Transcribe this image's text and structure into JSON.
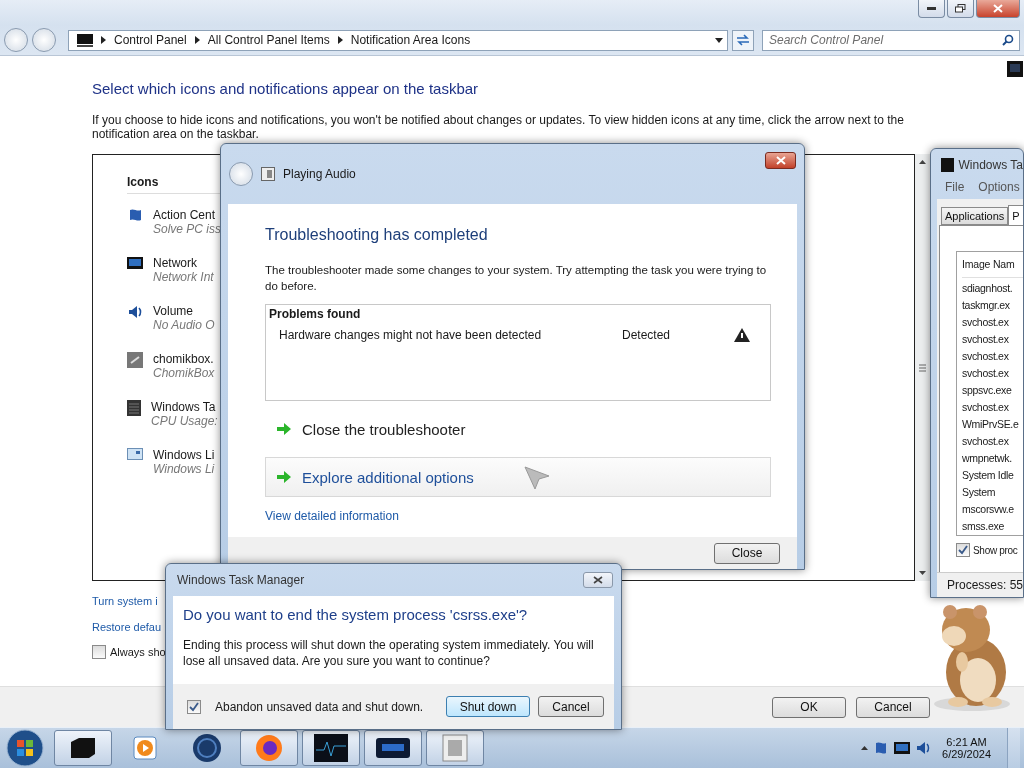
{
  "explorer": {
    "address": [
      "Control Panel",
      "All Control Panel Items",
      "Notification Area Icons"
    ],
    "search": {
      "placeholder": "Search Control Panel"
    },
    "heading": "Select which icons and notifications appear on the taskbar",
    "description": "If you choose to hide icons and notifications, you won't be notified about changes or updates. To view hidden icons at any time, click the arrow next to the notification area on the taskbar.",
    "icons_header": "Icons",
    "icons": [
      {
        "name": "Action Cent",
        "detail": "Solve PC iss"
      },
      {
        "name": "Network",
        "detail": "Network Int"
      },
      {
        "name": "Volume",
        "detail": "No Audio O"
      },
      {
        "name": "chomikbox.",
        "detail": "ChomikBox"
      },
      {
        "name": "Windows Ta",
        "detail": "CPU Usage:"
      },
      {
        "name": "Windows Li",
        "detail": "Windows Li"
      }
    ],
    "links": [
      "Turn system i",
      "Restore defau"
    ],
    "always_show": {
      "label": "Always sho",
      "checked": false
    },
    "buttons": [
      "OK",
      "Cancel"
    ]
  },
  "troubleshooter": {
    "title": "Playing Audio",
    "heading": "Troubleshooting has completed",
    "message": "The troubleshooter made some changes to your system. Try attempting the task you were trying to do before.",
    "problems_header": "Problems found",
    "problems": [
      {
        "problem": "Hardware changes might not have been detected",
        "status": "Detected"
      }
    ],
    "options": [
      {
        "label": "Close the troubleshooter",
        "selected": false
      },
      {
        "label": "Explore additional options",
        "selected": true
      }
    ],
    "details_link": "View detailed information",
    "close_button": "Close"
  },
  "task_manager": {
    "title": "Windows Ta",
    "menu": [
      "File",
      "Options"
    ],
    "tabs": [
      {
        "label": "Applications",
        "selected": false
      },
      {
        "label": "P",
        "selected": true
      }
    ],
    "column": "Image Nam",
    "processes": [
      "sdiagnhost.",
      "taskmgr.ex",
      "svchost.ex",
      "svchost.ex",
      "svchost.ex",
      "svchost.ex",
      "sppsvc.exe",
      "svchost.ex",
      "WmiPrvSE.e",
      "svchost.ex",
      "wmpnetwk.",
      "System Idle",
      "System",
      "mscorsvw.e",
      "smss.exe"
    ],
    "show_all": {
      "label": "Show proc",
      "checked": true
    },
    "status": "Processes: 55"
  },
  "confirm": {
    "title": "Windows Task Manager",
    "question": "Do you want to end the system process 'csrss.exe'?",
    "message": "Ending this process will shut down the operating system immediately.  You will lose all unsaved data.  Are you sure you want to continue?",
    "abandon": {
      "label": "Abandon unsaved data and shut down.",
      "checked": true
    },
    "buttons": [
      "Shut down",
      "Cancel"
    ]
  },
  "taskbar": {
    "apps": [
      {
        "active": true
      },
      {
        "active": false
      },
      {
        "active": false
      },
      {
        "active": true
      },
      {
        "active": true
      },
      {
        "active": true
      },
      {
        "active": true
      }
    ],
    "clock": {
      "time": "6:21 AM",
      "date": "6/29/2024"
    }
  }
}
